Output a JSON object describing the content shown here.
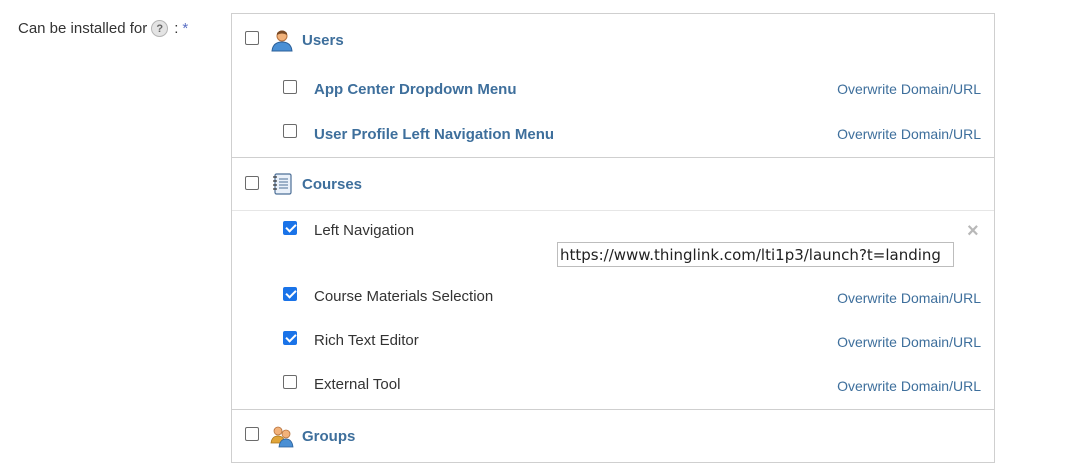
{
  "field": {
    "label": "Can be installed for",
    "help": "?",
    "colon": ":",
    "required": "*"
  },
  "sections": {
    "users": {
      "title": "Users",
      "checked": false,
      "icon": "user-icon",
      "items": [
        {
          "label": "App Center Dropdown Menu",
          "checked": false,
          "link": "Overwrite Domain/URL"
        },
        {
          "label": "User Profile Left Navigation Menu",
          "checked": false,
          "link": "Overwrite Domain/URL"
        }
      ]
    },
    "courses": {
      "title": "Courses",
      "checked": false,
      "icon": "notebook-icon",
      "items": [
        {
          "label": "Left Navigation",
          "checked": true,
          "url_value": "https://www.thinglink.com/lti1p3/launch?t=landing",
          "close": "×"
        },
        {
          "label": "Course Materials Selection",
          "checked": true,
          "link": "Overwrite Domain/URL"
        },
        {
          "label": "Rich Text Editor",
          "checked": true,
          "link": "Overwrite Domain/URL"
        },
        {
          "label": "External Tool",
          "checked": false,
          "link": "Overwrite Domain/URL"
        }
      ]
    },
    "groups": {
      "title": "Groups",
      "checked": false,
      "icon": "group-icon"
    }
  },
  "colors": {
    "link": "#3e6f9c",
    "checkbox_checked": "#1a73e8",
    "required": "#5a6fc4"
  }
}
